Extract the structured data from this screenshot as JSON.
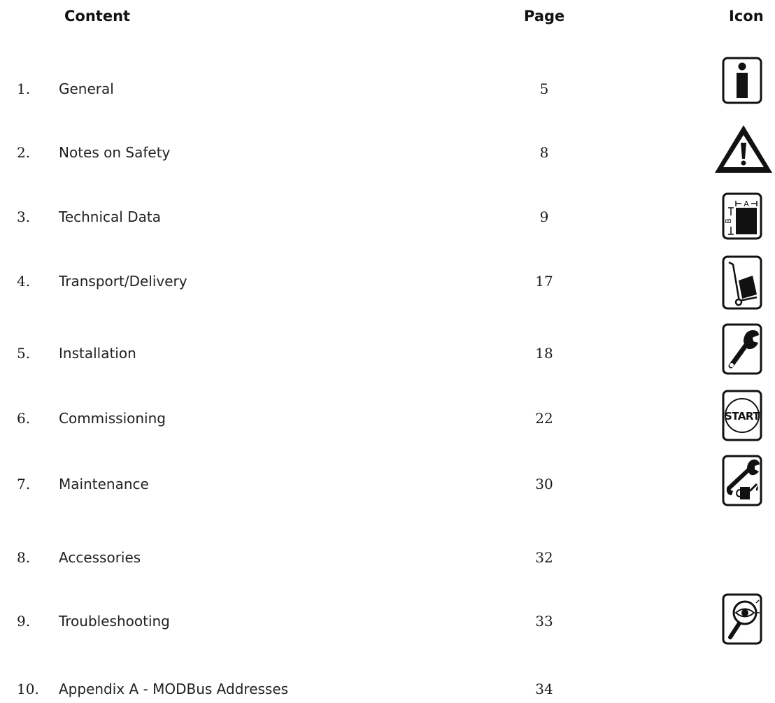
{
  "header": {
    "content": "Content",
    "page": "Page",
    "icon": "Icon"
  },
  "entries": [
    {
      "number": "1.",
      "title": "General",
      "page": "5",
      "icon": "info-icon"
    },
    {
      "number": "2.",
      "title": "Notes on Safety",
      "page": "8",
      "icon": "warning-triangle-icon"
    },
    {
      "number": "3.",
      "title": "Technical Data",
      "page": "9",
      "icon": "dimensions-icon"
    },
    {
      "number": "4.",
      "title": "Transport/Delivery",
      "page": "17",
      "icon": "hand-truck-icon"
    },
    {
      "number": "5.",
      "title": "Installation",
      "page": "18",
      "icon": "wrench-icon"
    },
    {
      "number": "6.",
      "title": "Commissioning",
      "page": "22",
      "icon": "start-icon"
    },
    {
      "number": "7.",
      "title": "Maintenance",
      "page": "30",
      "icon": "maintenance-wrench-oilcan-icon"
    },
    {
      "number": "8.",
      "title": "Accessories",
      "page": "32",
      "icon": ""
    },
    {
      "number": "9.",
      "title": "Troubleshooting",
      "page": "33",
      "icon": "magnifier-eye-icon"
    },
    {
      "number": "10.",
      "title": "Appendix A - MODBus Addresses",
      "page": "34",
      "icon": ""
    }
  ],
  "icon_labels": {
    "start": "START",
    "dim_a": "A",
    "dim_b": "B"
  }
}
